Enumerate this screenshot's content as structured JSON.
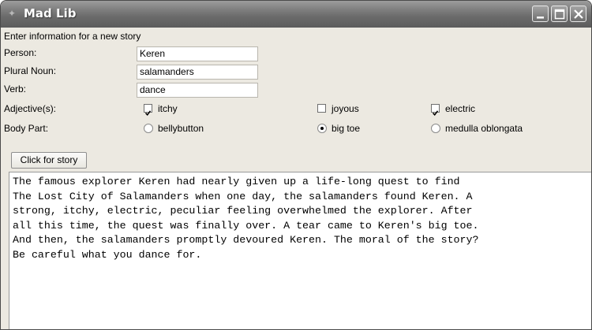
{
  "window": {
    "title": "Mad Lib"
  },
  "form": {
    "heading": "Enter information for a new story",
    "fields": [
      {
        "label": "Person:",
        "value": "Keren"
      },
      {
        "label": "Plural Noun:",
        "value": "salamanders"
      },
      {
        "label": "Verb:",
        "value": "dance"
      }
    ],
    "adjectives": {
      "label": "Adjective(s):",
      "options": [
        {
          "label": "itchy",
          "checked": true
        },
        {
          "label": "joyous",
          "checked": false
        },
        {
          "label": "electric",
          "checked": true
        }
      ]
    },
    "body_part": {
      "label": "Body Part:",
      "options": [
        {
          "label": "bellybutton",
          "selected": false
        },
        {
          "label": "big toe",
          "selected": true
        },
        {
          "label": "medulla oblongata",
          "selected": false
        }
      ]
    },
    "button_label": "Click for story"
  },
  "story": {
    "lines": [
      "The famous explorer Keren had nearly given up a life-long quest to find",
      "The Lost City of Salamanders when one day, the salamanders found Keren. A",
      "strong, itchy, electric, peculiar feeling overwhelmed the explorer. After",
      "all this time, the quest was finally over. A tear came to Keren's big toe.",
      "And then, the salamanders promptly devoured Keren. The moral of the story?",
      "Be careful what you dance for."
    ]
  },
  "icons": [
    "app-icon",
    "minimize-icon",
    "maximize-icon",
    "close-icon",
    "checkbox-check-icon",
    "radio-dot-icon"
  ]
}
